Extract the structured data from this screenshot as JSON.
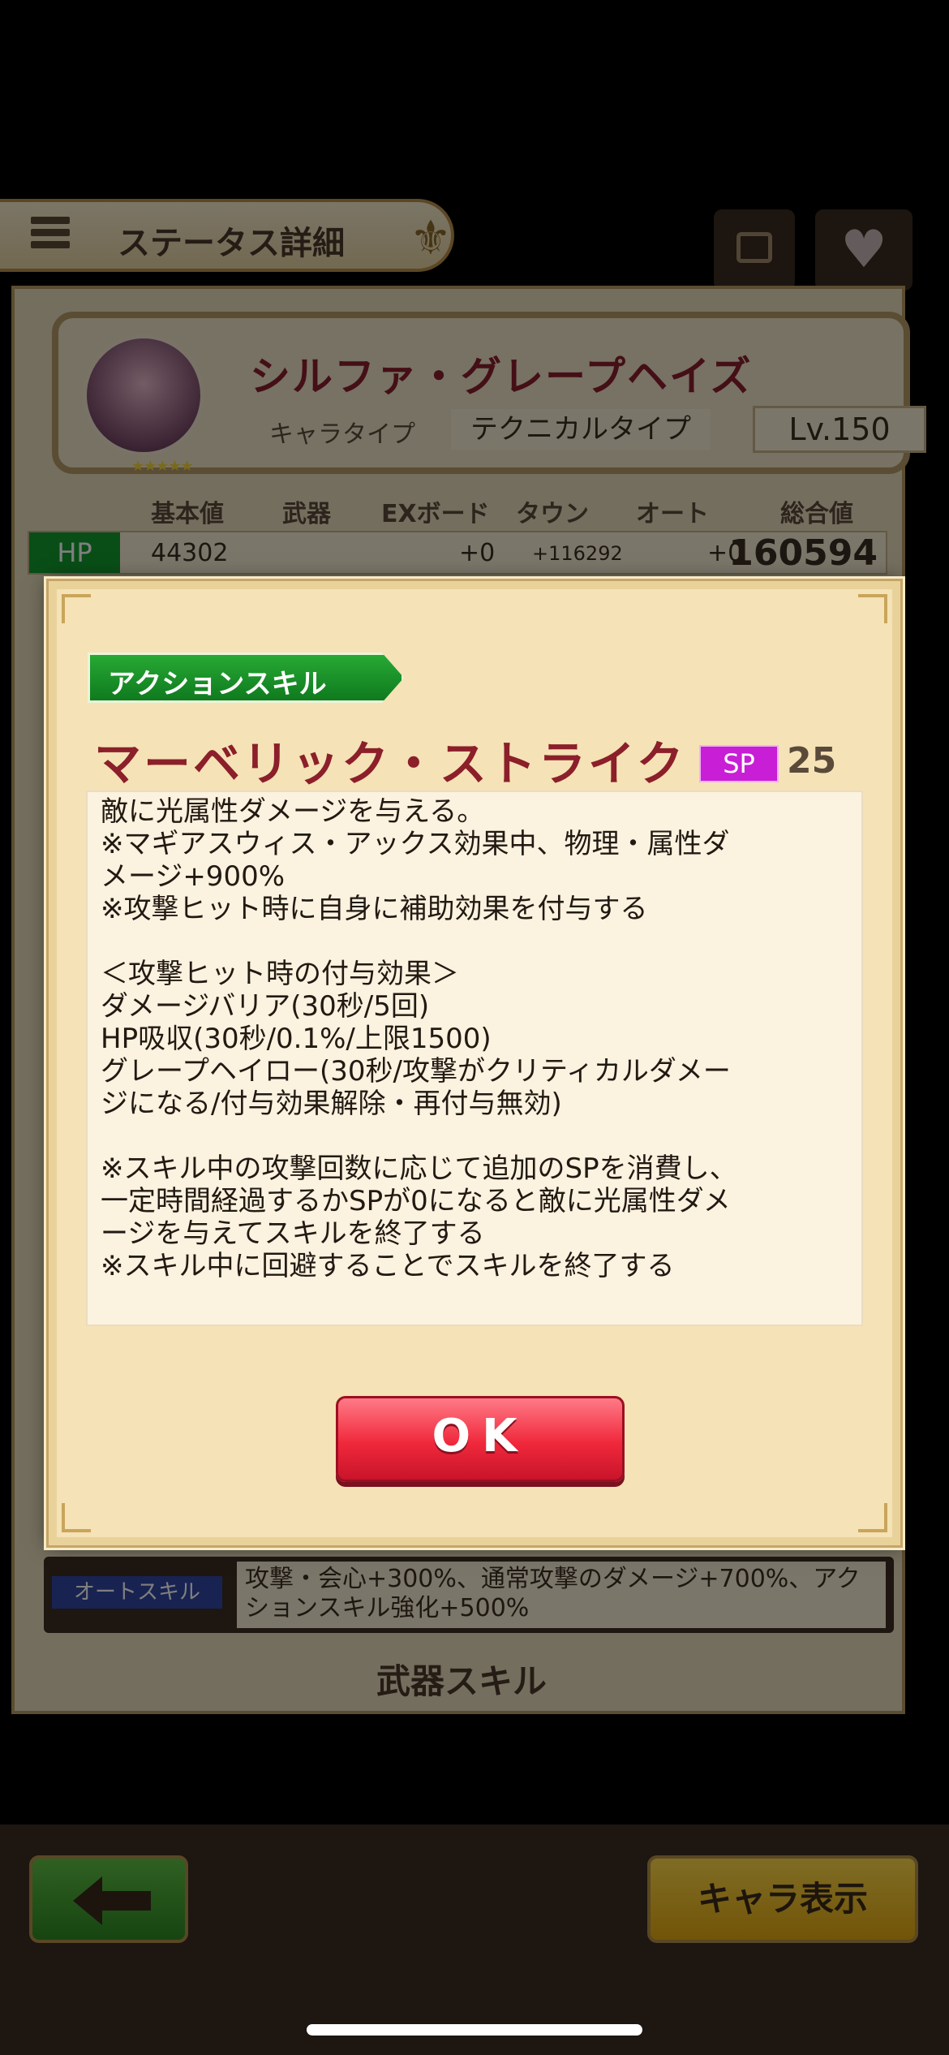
{
  "header": {
    "title": "ステータス詳細"
  },
  "character": {
    "name": "シルファ・グレープヘイズ",
    "type_label": "キャラタイプ",
    "type_value": "テクニカルタイプ",
    "level": "Lv.150"
  },
  "stats": {
    "headers": [
      "基本値",
      "武器",
      "EXボード",
      "タウン",
      "オート",
      "総合値"
    ],
    "hp": {
      "label": "HP",
      "base": "44302",
      "weapon": "",
      "ex_board": "+0",
      "town": "+116292",
      "auto": "+0",
      "total": "160594"
    }
  },
  "auto_skill": {
    "label": "オートスキル",
    "text": "攻撃・会心+300%、通常攻撃のダメージ+700%、アクションスキル強化+500%"
  },
  "weapon_skill_tab": "武器スキル",
  "char_view_button": "キャラ表示",
  "dialog": {
    "tag": "アクションスキル",
    "skill_name": "マーベリック・ストライク",
    "sp_label": "SP",
    "sp_value": "25",
    "description_lines": [
      "敵に光属性ダメージを与える。",
      "※マギアスウィス・アックス効果中、物理・属性ダ",
      "メージ+900%",
      "※攻撃ヒット時に自身に補助効果を付与する",
      "",
      "＜攻撃ヒット時の付与効果＞",
      "ダメージバリア(30秒/5回)",
      "HP吸収(30秒/0.1%/上限1500)",
      "グレープヘイロー(30秒/攻撃がクリティカルダメー",
      "ジになる/付与効果解除・再付与無効)",
      "",
      "※スキル中の攻撃回数に応じて追加のSPを消費し、",
      "一定時間経過するかSPが0になると敵に光属性ダメ",
      "ージを与えてスキルを終了する",
      "※スキル中に回避することでスキルを終了する"
    ],
    "ok_label": "OK"
  },
  "colors": {
    "skill_name": "#8b1f2a",
    "tag_green": "#1f9a2c",
    "sp_badge": "#c81ed6",
    "ok_red": "#f0283c"
  }
}
